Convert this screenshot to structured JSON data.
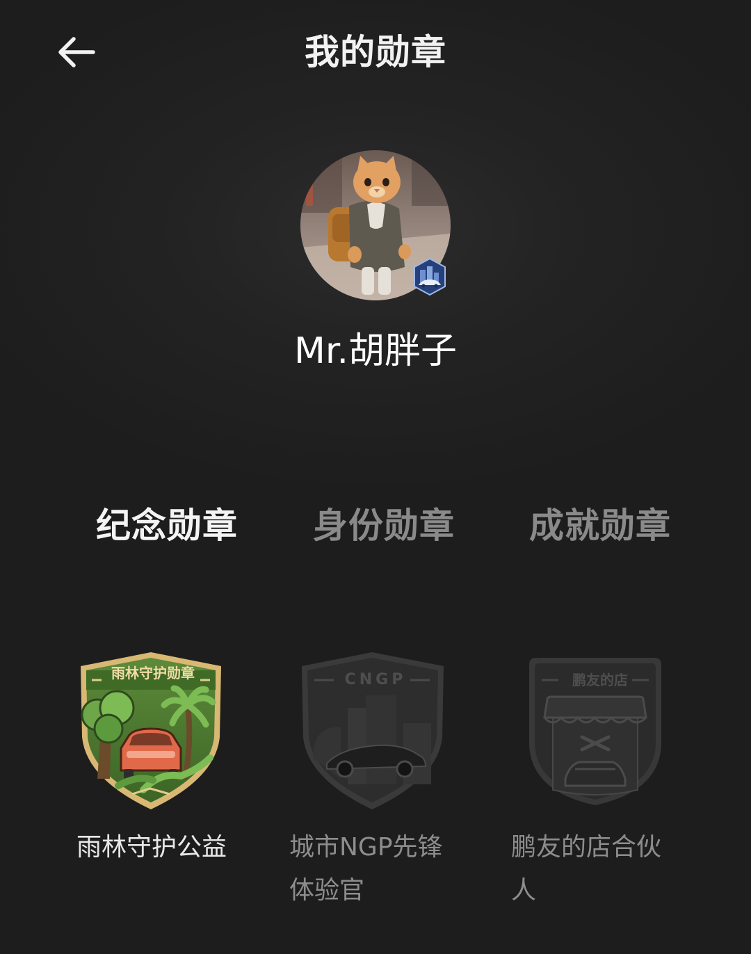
{
  "header": {
    "title": "我的勋章",
    "back_icon": "arrow-left-icon"
  },
  "profile": {
    "username": "Mr.胡胖子",
    "avatar_icon": "cat-avatar",
    "badge_icon": "city-car-badge-icon"
  },
  "tabs": [
    {
      "label": "纪念勋章",
      "active": true
    },
    {
      "label": "身份勋章",
      "active": false
    },
    {
      "label": "成就勋章",
      "active": false
    }
  ],
  "medals": [
    {
      "label": "雨林守护公益",
      "caption": "雨林守护勋章",
      "unlocked": true,
      "icon": "rainforest-medal-icon"
    },
    {
      "label": "城市NGP先锋体验官",
      "caption": "CNGP",
      "unlocked": false,
      "icon": "cngp-medal-icon"
    },
    {
      "label": "鹏友的店合伙人",
      "caption": "鹏友的店",
      "unlocked": false,
      "icon": "shop-medal-icon"
    }
  ],
  "colors": {
    "background": "#1d1d1d",
    "active_text": "#f4f4f4",
    "inactive_text": "#8a8a8a",
    "medal_green": "#4f7a2e",
    "medal_gold": "#d8b873",
    "medal_car": "#e0694a",
    "locked_medal": "#2e2e2e"
  }
}
